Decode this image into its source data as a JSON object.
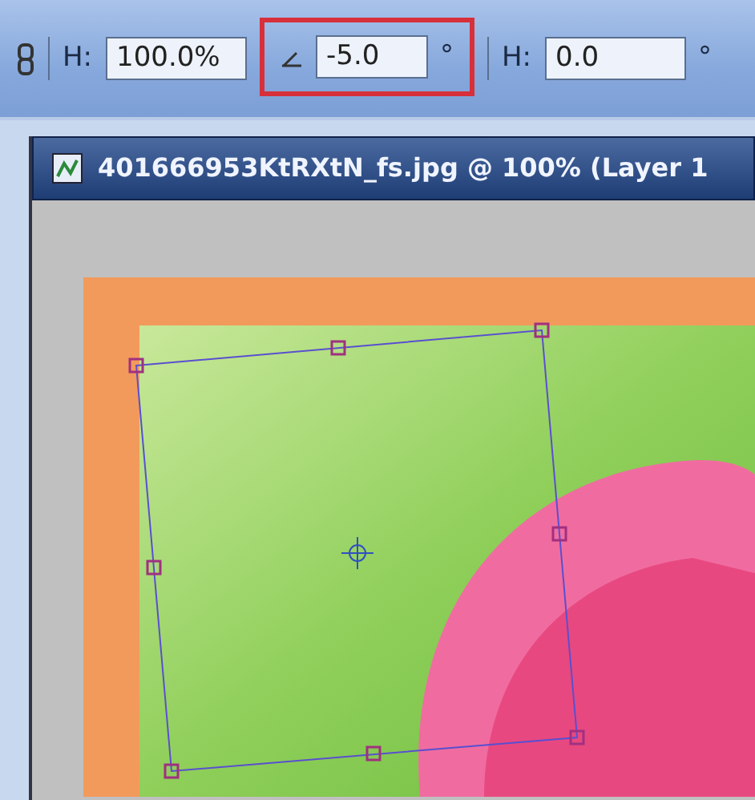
{
  "options_bar": {
    "fields": [
      {
        "kind": "link"
      },
      {
        "kind": "field",
        "label": "H:",
        "value": "100.0%",
        "highlighted": false
      },
      {
        "kind": "angle_field",
        "value": "-5.0",
        "unit": "°",
        "highlighted": true
      },
      {
        "kind": "field",
        "label": "H:",
        "value": "0.0",
        "unit": "°",
        "highlighted": false
      }
    ]
  },
  "document": {
    "title": "401666953KtRXtN_fs.jpg @ 100% (Layer 1"
  }
}
